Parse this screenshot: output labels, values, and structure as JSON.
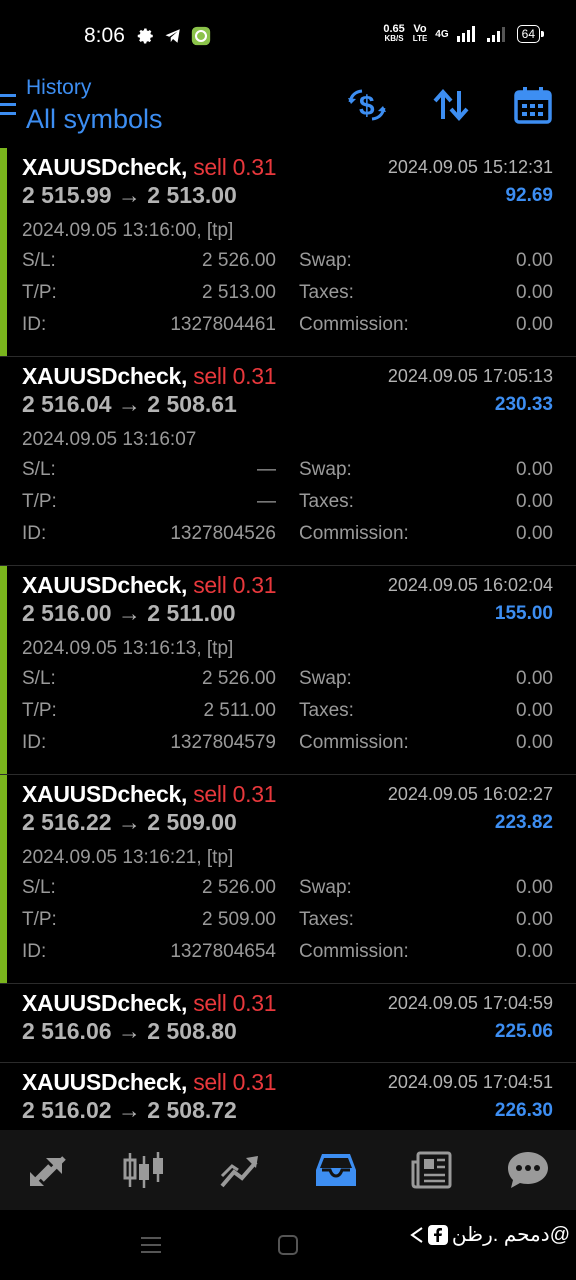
{
  "status_bar": {
    "time": "8:06",
    "net_speed_value": "0.65",
    "net_speed_unit": "KB/S",
    "volte_top": "Vo",
    "volte_bottom": "LTE",
    "network": "4G",
    "battery": "64",
    "icons_left": [
      "gear-icon",
      "telegram-icon",
      "app-icon"
    ]
  },
  "header": {
    "subtitle": "History",
    "title": "All symbols",
    "buttons": [
      "currency-exchange-icon",
      "sort-icon",
      "calendar-icon"
    ]
  },
  "colors": {
    "accent_blue": "#3d8ef2",
    "sell_red": "#e8383c",
    "tp_green_bar": "#7ab51d",
    "background": "#000000"
  },
  "deals": [
    {
      "symbol": "XAUUSDcheck",
      "side": "sell 0.31",
      "close_time": "2024.09.05 15:12:31",
      "prices": "2 515.99 → 2 513.00",
      "profit": "92.69",
      "open_time": "2024.09.05 13:16:00, [tp]",
      "sl": "2 526.00",
      "tp": "2 513.00",
      "id": "1327804461",
      "swap": "0.00",
      "taxes": "0.00",
      "commission": "0.00",
      "tp_hit": true
    },
    {
      "symbol": "XAUUSDcheck",
      "side": "sell 0.31",
      "close_time": "2024.09.05 17:05:13",
      "prices": "2 516.04 → 2 508.61",
      "profit": "230.33",
      "open_time": "2024.09.05 13:16:07",
      "sl": "—",
      "tp": "—",
      "id": "1327804526",
      "swap": "0.00",
      "taxes": "0.00",
      "commission": "0.00",
      "tp_hit": false
    },
    {
      "symbol": "XAUUSDcheck",
      "side": "sell 0.31",
      "close_time": "2024.09.05 16:02:04",
      "prices": "2 516.00 → 2 511.00",
      "profit": "155.00",
      "open_time": "2024.09.05 13:16:13, [tp]",
      "sl": "2 526.00",
      "tp": "2 511.00",
      "id": "1327804579",
      "swap": "0.00",
      "taxes": "0.00",
      "commission": "0.00",
      "tp_hit": true
    },
    {
      "symbol": "XAUUSDcheck",
      "side": "sell 0.31",
      "close_time": "2024.09.05 16:02:27",
      "prices": "2 516.22 → 2 509.00",
      "profit": "223.82",
      "open_time": "2024.09.05 13:16:21, [tp]",
      "sl": "2 526.00",
      "tp": "2 509.00",
      "id": "1327804654",
      "swap": "0.00",
      "taxes": "0.00",
      "commission": "0.00",
      "tp_hit": true
    },
    {
      "symbol": "XAUUSDcheck",
      "side": "sell 0.31",
      "close_time": "2024.09.05 17:04:59",
      "prices": "2 516.06 → 2 508.80",
      "profit": "225.06"
    },
    {
      "symbol": "XAUUSDcheck",
      "side": "sell 0.31",
      "close_time": "2024.09.05 17:04:51",
      "prices": "2 516.02 → 2 508.72",
      "profit": "226.30"
    }
  ],
  "labels": {
    "sl": "S/L:",
    "tp": "T/P:",
    "id": "ID:",
    "swap": "Swap:",
    "taxes": "Taxes:",
    "commission": "Commission:",
    "comma": ","
  },
  "bottom_nav": [
    {
      "name": "quotes",
      "icon": "quotes-arrows-icon",
      "active": false
    },
    {
      "name": "chart",
      "icon": "candlestick-icon",
      "active": false
    },
    {
      "name": "trade",
      "icon": "trend-line-icon",
      "active": false
    },
    {
      "name": "history",
      "icon": "inbox-tray-icon",
      "active": true
    },
    {
      "name": "news",
      "icon": "newspaper-icon",
      "active": false
    },
    {
      "name": "messages",
      "icon": "chat-bubble-icon",
      "active": false
    }
  ],
  "watermark": "دمحم .رظن@"
}
